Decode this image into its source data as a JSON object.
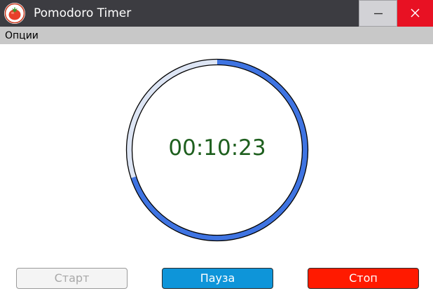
{
  "window": {
    "title": "Pomodoro Timer",
    "icon": "tomato-icon",
    "controls": [
      "minimize-icon",
      "close-icon"
    ]
  },
  "menu": {
    "items": [
      {
        "label": "Опции"
      }
    ]
  },
  "timer": {
    "display": "00:10:23",
    "progress_remaining_fraction": 0.7,
    "colors": {
      "progress": "#3f74e2",
      "track": "#dde5f4",
      "text": "#1e5f1e"
    }
  },
  "buttons": {
    "start_label": "Старт",
    "pause_label": "Пауза",
    "stop_label": "Стоп"
  },
  "colors": {
    "titlebar": "#3c3c41",
    "close": "#e81123",
    "menubar": "#c8c8c8",
    "pause": "#0e95d9",
    "stop": "#ff1a00"
  }
}
